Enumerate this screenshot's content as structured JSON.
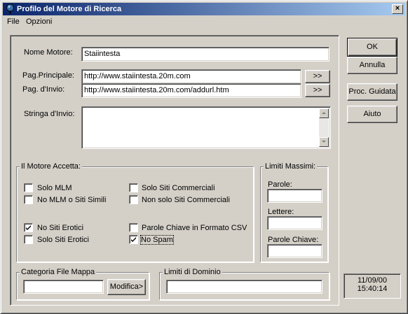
{
  "window": {
    "title": "Profilo del Motore di Ricerca",
    "close_label": "×"
  },
  "menu": {
    "items": [
      "File",
      "Opzioni"
    ]
  },
  "form": {
    "nome_motore_label": "Nome Motore:",
    "nome_motore_value": "Staiintesta",
    "pag_principale_label": "Pag.Principale:",
    "pag_principale_value": "http://www.staiintesta.20m.com",
    "pag_invio_label": "Pag. d'Invio:",
    "pag_invio_value": "http://www.staiintesta.20m.com/addurl.htm",
    "stringa_invio_label": "Stringa d'Invio:",
    "stringa_invio_value": "",
    "arrow_label": ">>"
  },
  "accetta": {
    "legend": "Il Motore Accetta:",
    "items": [
      {
        "label": "Solo MLM",
        "checked": false
      },
      {
        "label": "No MLM o Siti Simili",
        "checked": false
      },
      {
        "label": "No Siti Erotici",
        "checked": true
      },
      {
        "label": "Solo Siti Erotici",
        "checked": false
      },
      {
        "label": "Solo Siti Commerciali",
        "checked": false
      },
      {
        "label": "Non solo Siti Commerciali",
        "checked": false
      },
      {
        "label": "Parole Chiave in Formato CSV",
        "checked": false
      },
      {
        "label": "No Spam",
        "checked": true
      }
    ]
  },
  "limiti": {
    "legend": "Limiti Massimi:",
    "parole_label": "Parole:",
    "lettere_label": "Lettere:",
    "parole_chiave_label": "Parole Chiave:",
    "parole_value": "",
    "lettere_value": "",
    "parole_chiave_value": ""
  },
  "categoria": {
    "legend": "Categoria File Mappa",
    "value": "",
    "button": "Modifica>"
  },
  "dominio": {
    "legend": "Limiti di Dominio",
    "value": ""
  },
  "buttons": {
    "ok": "OK",
    "annulla": "Annulla",
    "proc_guidata": "Proc. Guidata",
    "aiuto": "Aiuto"
  },
  "status": {
    "date": "11/09/00",
    "time": "15:40:14"
  }
}
